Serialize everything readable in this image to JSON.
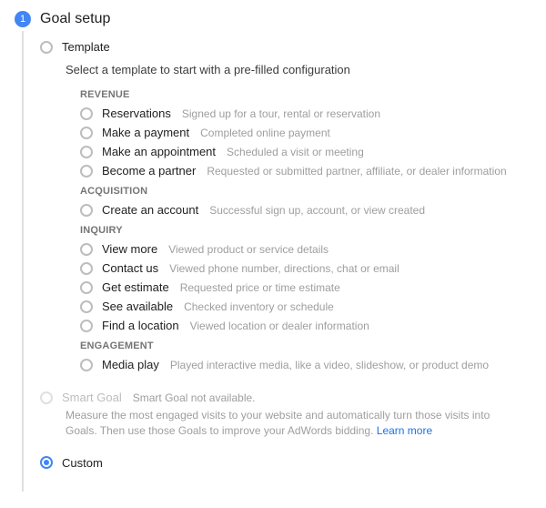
{
  "step": {
    "number": "1",
    "title": "Goal setup"
  },
  "template": {
    "label": "Template",
    "instruction": "Select a template to start with a pre-filled configuration",
    "groups": [
      {
        "title": "REVENUE",
        "items": [
          {
            "label": "Reservations",
            "sub": "Signed up for a tour, rental or reservation"
          },
          {
            "label": "Make a payment",
            "sub": "Completed online payment"
          },
          {
            "label": "Make an appointment",
            "sub": "Scheduled a visit or meeting"
          },
          {
            "label": "Become a partner",
            "sub": "Requested or submitted partner, affiliate, or dealer information"
          }
        ]
      },
      {
        "title": "ACQUISITION",
        "items": [
          {
            "label": "Create an account",
            "sub": "Successful sign up, account, or view created"
          }
        ]
      },
      {
        "title": "INQUIRY",
        "items": [
          {
            "label": "View more",
            "sub": "Viewed product or service details"
          },
          {
            "label": "Contact us",
            "sub": "Viewed phone number, directions, chat or email"
          },
          {
            "label": "Get estimate",
            "sub": "Requested price or time estimate"
          },
          {
            "label": "See available",
            "sub": "Checked inventory or schedule"
          },
          {
            "label": "Find a location",
            "sub": "Viewed location or dealer information"
          }
        ]
      },
      {
        "title": "ENGAGEMENT",
        "items": [
          {
            "label": "Media play",
            "sub": "Played interactive media, like a video, slideshow, or product demo"
          }
        ]
      }
    ]
  },
  "smart_goal": {
    "label": "Smart Goal",
    "status": "Smart Goal not available.",
    "desc": "Measure the most engaged visits to your website and automatically turn those visits into Goals. Then use those Goals to improve your AdWords bidding.",
    "learn_more": "Learn more"
  },
  "custom": {
    "label": "Custom"
  }
}
